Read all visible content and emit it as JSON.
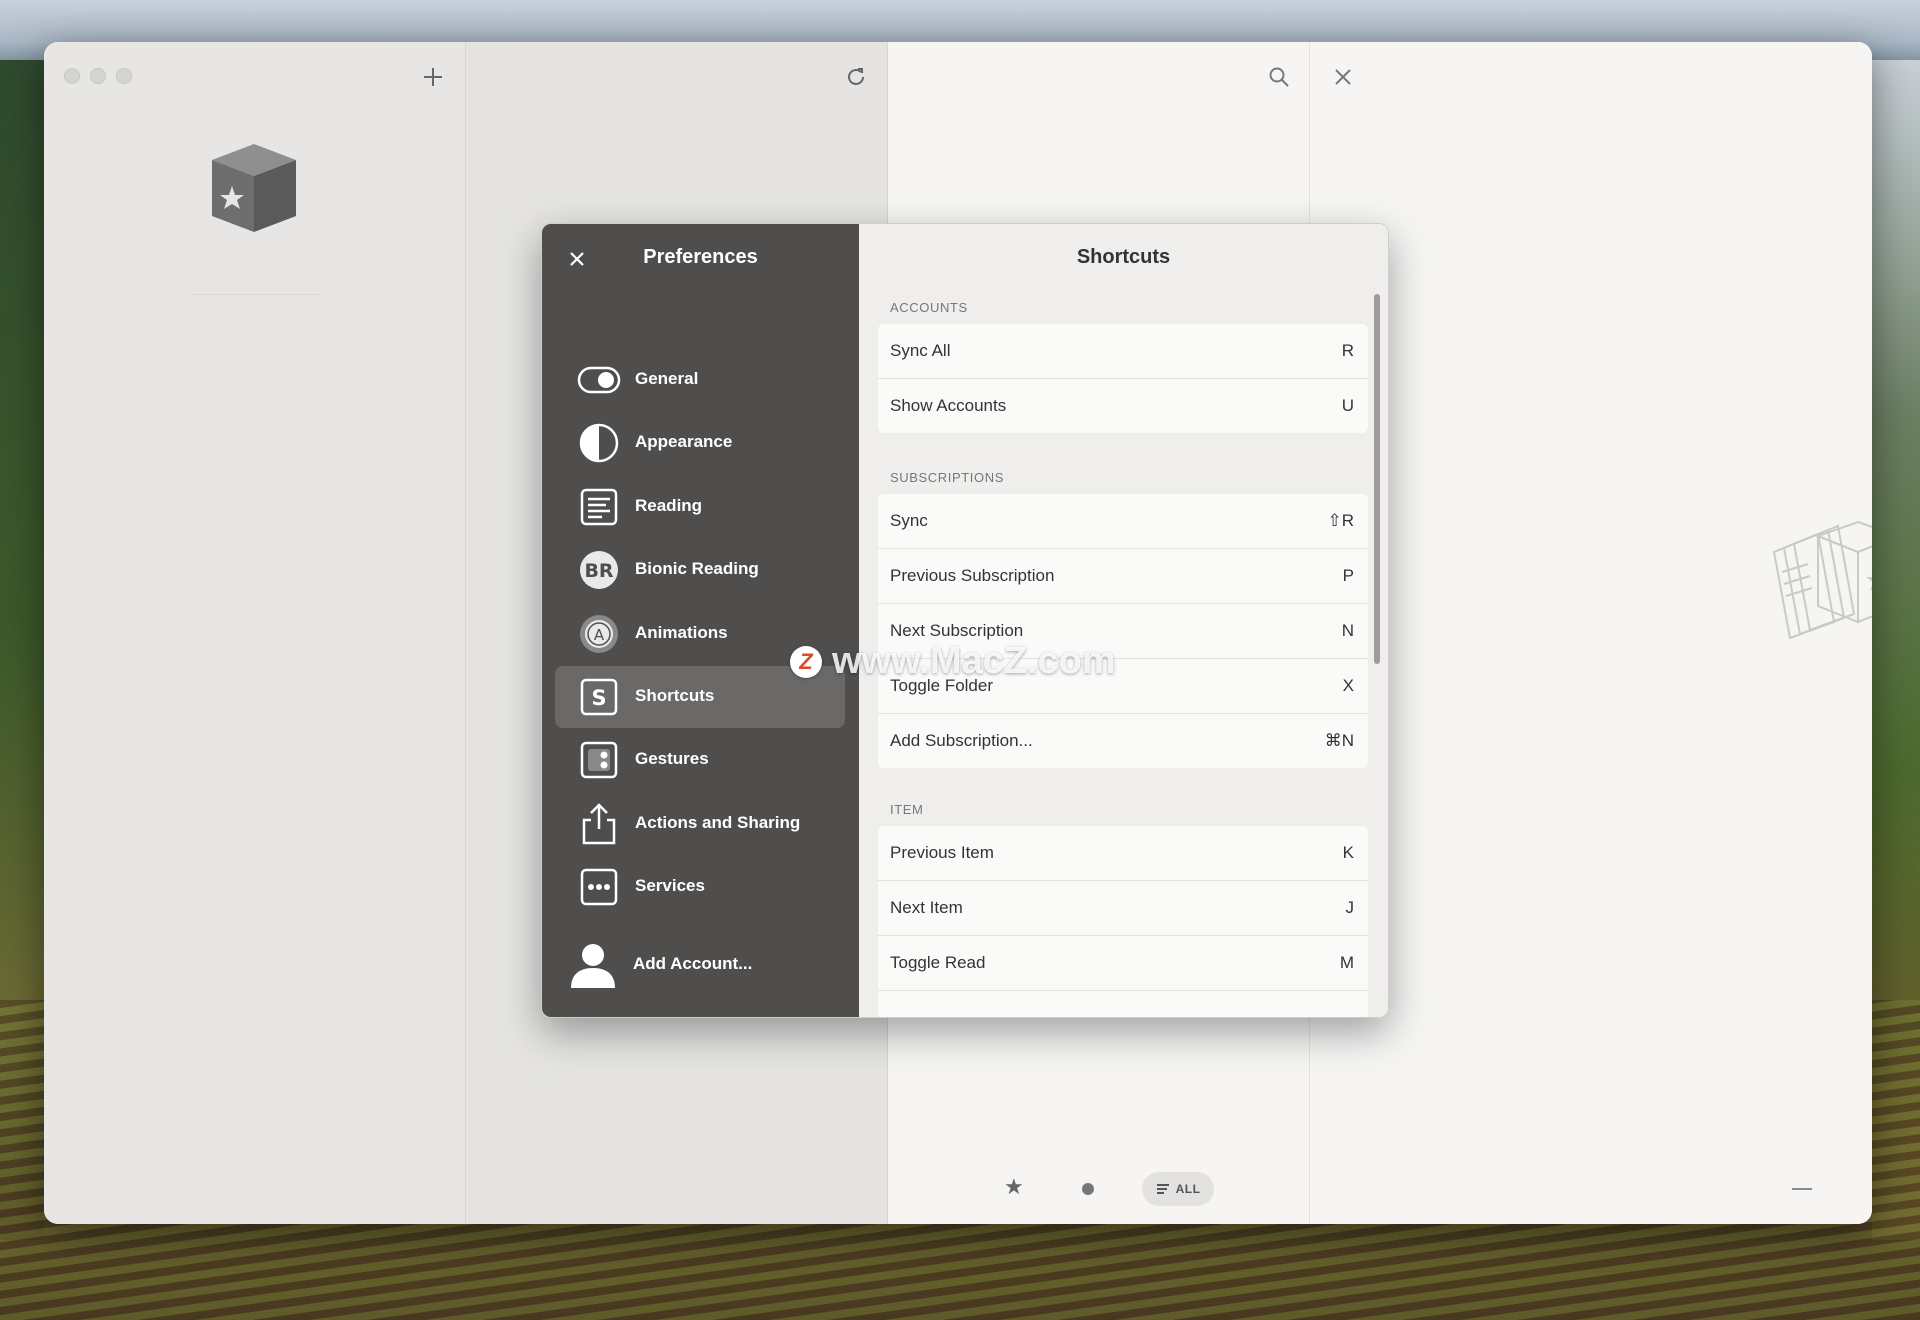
{
  "toolbar": {
    "add_icon": "plus-icon",
    "refresh_icon": "refresh-icon",
    "search_icon": "search-icon",
    "close_icon": "close-icon"
  },
  "bottom_bar": {
    "filter_all_label": "ALL",
    "star_icon": "star-icon",
    "unread_icon": "dot-icon"
  },
  "preferences": {
    "title": "Preferences",
    "nav": [
      {
        "label": "General",
        "icon": "toggle-icon"
      },
      {
        "label": "Appearance",
        "icon": "half-circle-icon"
      },
      {
        "label": "Reading",
        "icon": "document-icon"
      },
      {
        "label": "Bionic Reading",
        "icon": "bionic-reading-icon",
        "badge": "BR"
      },
      {
        "label": "Animations",
        "icon": "animations-icon",
        "badge": "A"
      },
      {
        "label": "Shortcuts",
        "icon": "shortcuts-icon",
        "badge": "S",
        "active": true
      },
      {
        "label": "Gestures",
        "icon": "gestures-icon"
      },
      {
        "label": "Actions and Sharing",
        "icon": "share-icon"
      },
      {
        "label": "Services",
        "icon": "services-icon"
      }
    ],
    "add_account": "Add Account..."
  },
  "shortcuts": {
    "title": "Shortcuts",
    "sections": [
      {
        "header": "ACCOUNTS",
        "rows": [
          {
            "name": "Sync All",
            "key": "R"
          },
          {
            "name": "Show Accounts",
            "key": "U"
          }
        ]
      },
      {
        "header": "SUBSCRIPTIONS",
        "rows": [
          {
            "name": "Sync",
            "key": "⇧R"
          },
          {
            "name": "Previous Subscription",
            "key": "P"
          },
          {
            "name": "Next Subscription",
            "key": "N"
          },
          {
            "name": "Toggle Folder",
            "key": "X"
          },
          {
            "name": "Add Subscription...",
            "key": "⌘N"
          }
        ]
      },
      {
        "header": "ITEM",
        "rows": [
          {
            "name": "Previous Item",
            "key": "K"
          },
          {
            "name": "Next Item",
            "key": "J"
          },
          {
            "name": "Toggle Read",
            "key": "M"
          },
          {
            "name": "",
            "key": ""
          }
        ]
      }
    ]
  },
  "watermark": {
    "badge": "Z",
    "text": "www.MacZ.com"
  },
  "colors": {
    "sidebar": "#4f4e4c",
    "sidebar_active": "#6a6967",
    "panel": "#efeeec"
  }
}
